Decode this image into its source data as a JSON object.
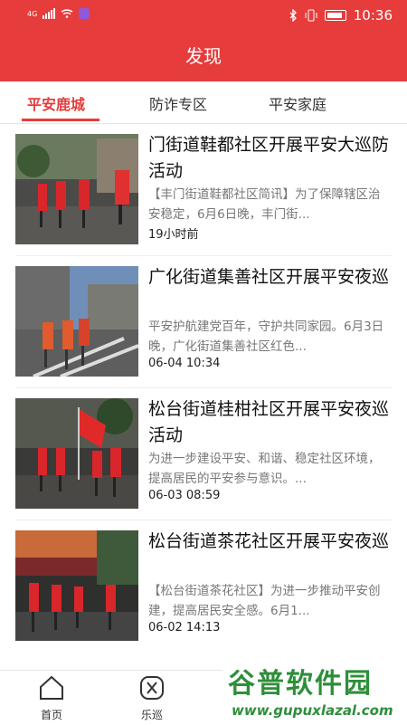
{
  "status_bar": {
    "carrier": "4G",
    "time": "10:36"
  },
  "header": {
    "title": "发现"
  },
  "tabs": [
    {
      "label": "平安鹿城",
      "active": true
    },
    {
      "label": "防诈专区",
      "active": false
    },
    {
      "label": "平安家庭",
      "active": false
    }
  ],
  "news": [
    {
      "title": "门街道鞋都社区开展平安大巡防活动",
      "summary": "【丰门街道鞋都社区简讯】为了保障辖区治安稳定，6月6日晚，丰门街...",
      "time": "19小时前"
    },
    {
      "title": "广化街道集善社区开展平安夜巡",
      "summary": "平安护航建党百年，守护共同家园。6月3日晚，广化街道集善社区红色...",
      "time": "06-04 10:34"
    },
    {
      "title": "松台街道桂柑社区开展平安夜巡活动",
      "summary": "为进一步建设平安、和谐、稳定社区环境，提高居民的平安参与意识。...",
      "time": "06-03 08:59"
    },
    {
      "title": "松台街道茶花社区开展平安夜巡",
      "summary": "【松台街道茶花社区】为进一步推动平安创建，提高居民安全感。6月1...",
      "time": "06-02 14:13"
    }
  ],
  "tabbar": [
    {
      "label": "首页",
      "icon": "home-icon"
    },
    {
      "label": "乐巡",
      "icon": "tools-icon"
    }
  ],
  "watermark": {
    "text": "谷普软件园",
    "url": "www.gupuxlazal.com"
  },
  "colors": {
    "brand": "#e63c3c"
  }
}
